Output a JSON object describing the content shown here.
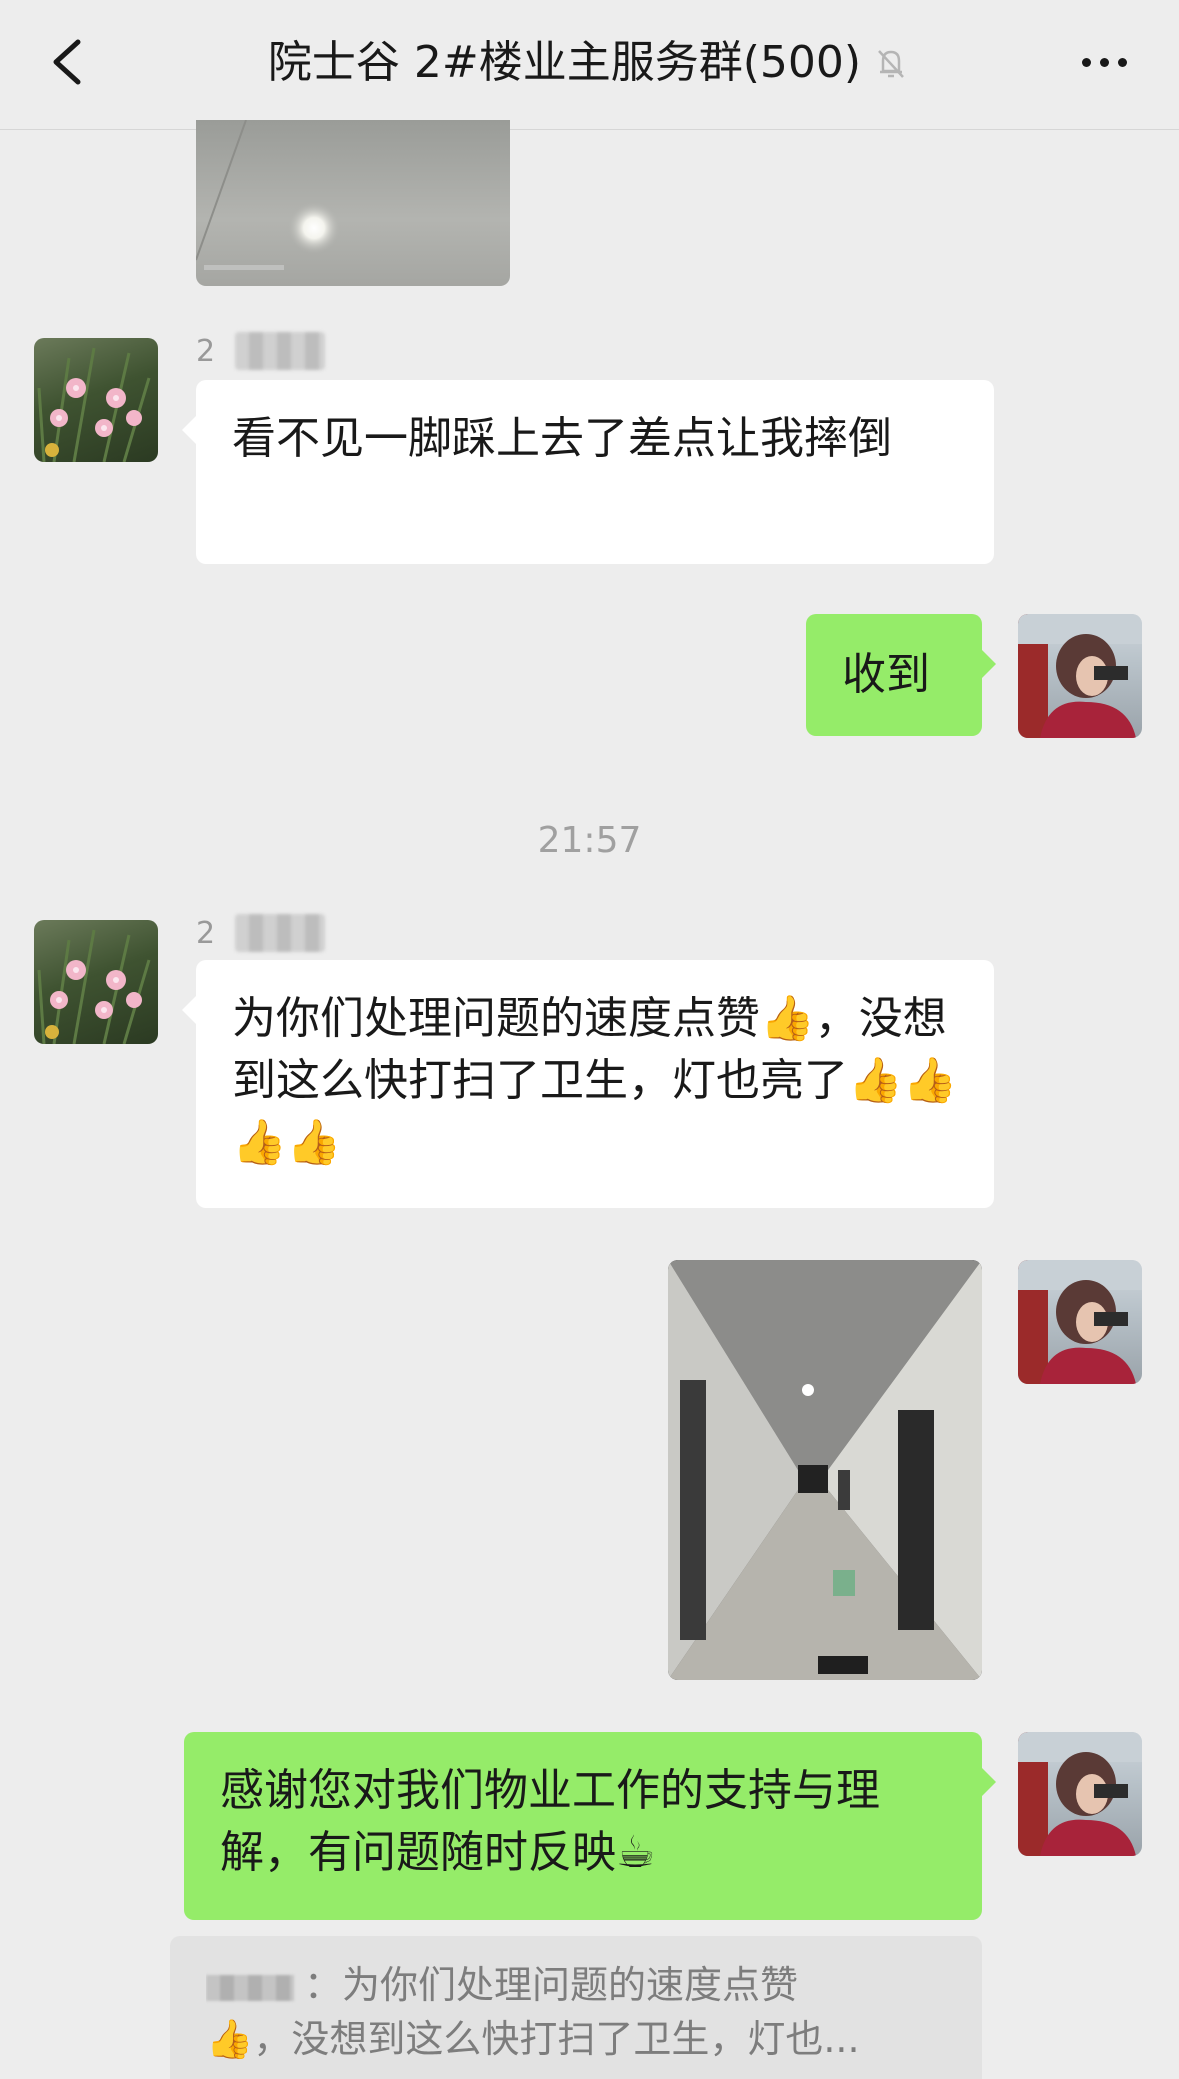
{
  "header": {
    "title": "院士谷 2#楼业主服务群(500)",
    "mute_icon": "bell-off-icon",
    "back_icon": "chevron-left-icon",
    "more_icon": "more-dots-icon"
  },
  "messages": {
    "m1_sender_initial": "2",
    "m1_text": "看不见一脚踩上去了差点让我摔倒",
    "m2_text": "收到",
    "time": "21:57",
    "m3_sender_initial": "2",
    "m3_text": "为你们处理问题的速度点赞👍，没想到这么快打扫了卫生，灯也亮了👍👍👍👍",
    "m5_text": "感谢您对我们物业工作的支持与理解，有问题随时反映☕"
  },
  "quote": {
    "separator": "：",
    "line1": "为你们处理问题的速度点赞",
    "line2": "👍，没想到这么快打扫了卫生，灯也..."
  },
  "colors": {
    "background": "#ededed",
    "bubble_self": "#95ec69",
    "bubble_other": "#ffffff"
  }
}
